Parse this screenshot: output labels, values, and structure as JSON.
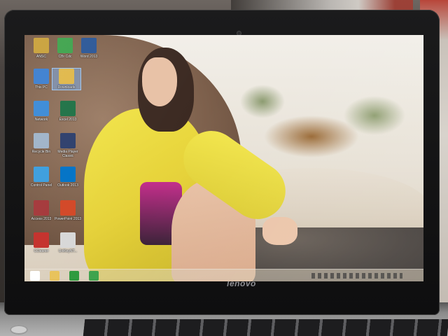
{
  "photo": {
    "brand_logo": "lenovo"
  },
  "desktop": {
    "icons": [
      {
        "label": "ANSC",
        "icon": "folder-icon",
        "color": "#c9a13a"
      },
      {
        "label": "CBr Cdc",
        "icon": "app-icon",
        "color": "#3fa34d"
      },
      {
        "label": "Word 2013",
        "icon": "word-icon",
        "color": "#2b5797"
      },
      {
        "label": "This PC",
        "icon": "computer-icon",
        "color": "#3c7fd0"
      },
      {
        "label": "Downloads",
        "icon": "folder-icon",
        "color": "#e0b84a"
      },
      {
        "label": "Network",
        "icon": "network-icon",
        "color": "#3a8ad6"
      },
      {
        "label": "Excel 2013",
        "icon": "excel-icon",
        "color": "#1e7145"
      },
      {
        "label": "Recycle Bin",
        "icon": "recycle-bin-icon",
        "color": "#9fb3c8"
      },
      {
        "label": "Media Player Classic",
        "icon": "media-player-icon",
        "color": "#2c3e6b"
      },
      {
        "label": "Control Panel",
        "icon": "control-panel-icon",
        "color": "#3b9ddd"
      },
      {
        "label": "Outlook 2013",
        "icon": "outlook-icon",
        "color": "#0072c6"
      },
      {
        "label": "Access 2013",
        "icon": "access-icon",
        "color": "#a4373a"
      },
      {
        "label": "PowerPoint 2013",
        "icon": "powerpoint-icon",
        "color": "#d24726"
      },
      {
        "label": "CCleaner",
        "icon": "ccleaner-icon",
        "color": "#c4302b"
      },
      {
        "label": "UniKeyNT...",
        "icon": "unikey-icon",
        "color": "#d8d8d8"
      }
    ]
  },
  "taskbar": {
    "buttons": [
      {
        "icon": "windows-start-icon",
        "color": "#ffffff"
      },
      {
        "icon": "file-explorer-icon",
        "color": "#e8c25a"
      },
      {
        "icon": "store-icon",
        "color": "#2d9a3e"
      },
      {
        "icon": "app-icon",
        "color": "#3fa34d"
      }
    ],
    "clock": {
      "time": "",
      "date": ""
    }
  }
}
